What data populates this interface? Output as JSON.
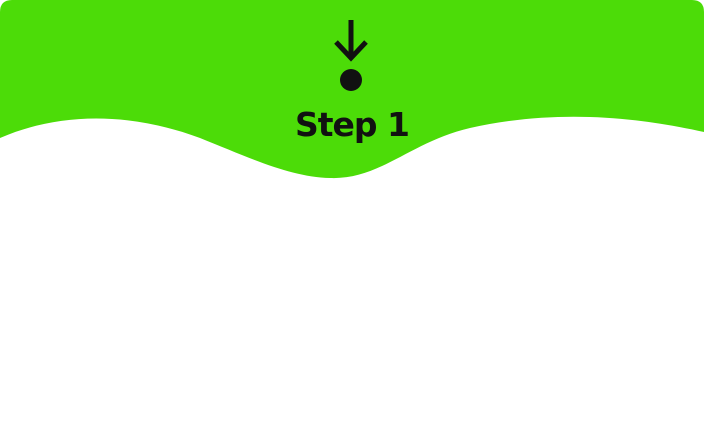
{
  "step": {
    "title": "Step 1"
  },
  "colors": {
    "accent": "#4CDC08",
    "ink": "#111111",
    "background": "#FFFFFF"
  },
  "icons": {
    "arrow": "down-arrow-icon",
    "dot": "dot-icon"
  }
}
